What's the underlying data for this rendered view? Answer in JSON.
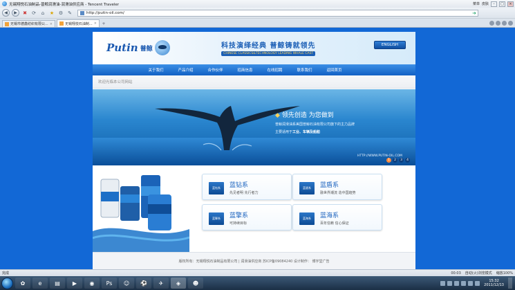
{
  "browser": {
    "title": "无锡翔悦石油制品-普鲸润滑油-润滑油供应商 - Tencent Traveler",
    "title_links": [
      "菜单",
      "皮肤"
    ],
    "url": "http://putin-oil.com/",
    "tabs": [
      {
        "label": "无锡市德鑫纺织有限公..."
      },
      {
        "label": "无锡翔悦石油制..."
      }
    ],
    "status_text": "完成",
    "status_right": [
      "00:03",
      "自动(火)浏览模式",
      "缩放100%"
    ]
  },
  "site": {
    "logo_en": "Putin",
    "logo_cn": "普鲸",
    "slogan_cn": "科技演绎经典    普鲸铸就领先",
    "slogan_en": "CHINESE CLASSICS&TECHNOLOGY LEADING WHALE CAST",
    "english_button": "ENGLISH",
    "nav": [
      "关于我们",
      "产品介绍",
      "合作伙伴",
      "招商信息",
      "在线招聘",
      "联系我们",
      "返回首页"
    ],
    "welcome": "欢迎光临本公司网站",
    "banner": {
      "headline": "领先创造 为您做到",
      "sub1": "普鲸润滑油系美国普鲸石油有限公司旗下的主力品牌",
      "sub2_prefix": "主要适用于",
      "sub2_strong": "工业、车辆及船舶",
      "url": "HTTP://WWW.PUTIN-OIL.COM",
      "pages": [
        "1",
        "2",
        "3",
        "4"
      ]
    },
    "cards": [
      {
        "title": "蓝钻系",
        "desc": "先见者明 先行者力",
        "icon": "蓝钻系"
      },
      {
        "title": "蓝盾系",
        "desc": "融世界潮流 造中国趋势",
        "icon": "蓝盾系"
      },
      {
        "title": "蓝擎系",
        "desc": "可持续目标",
        "icon": "蓝擎系"
      },
      {
        "title": "蓝海系",
        "desc": "百年信赖 信心保证",
        "icon": "蓝海系"
      }
    ],
    "footer": "版权所有：无锡翔悦石油制品有限公司 | 润滑油供应商   苏ICP备09084240   设计制作：  博宇堂广告"
  },
  "taskbar": {
    "time": "15:32",
    "date": "2011/12/13"
  },
  "colors": {
    "brand_blue": "#1a58b0",
    "page_bg": "#1268d6",
    "nav_blue": "#1261c4"
  }
}
